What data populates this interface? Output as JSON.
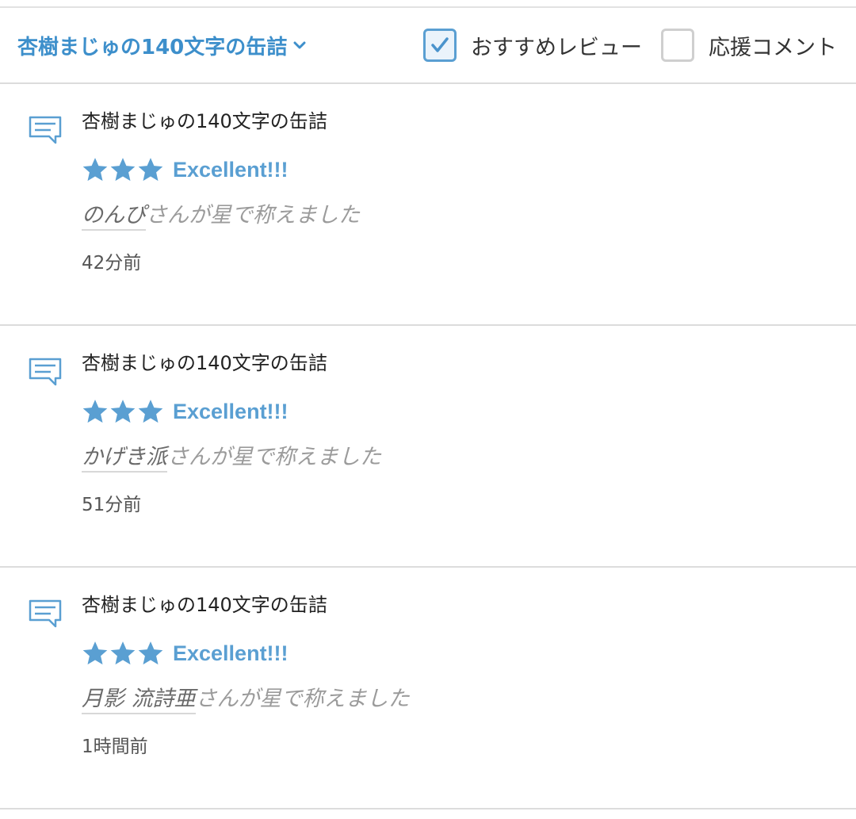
{
  "header": {
    "work_title": "杏樹まじゅの140文字の缶詰",
    "filters": [
      {
        "label": "おすすめレビュー",
        "checked": true
      },
      {
        "label": "応援コメント",
        "checked": false
      }
    ]
  },
  "colors": {
    "accent": "#5a9fd2",
    "link": "#3d8fcb",
    "divider": "#dcdcdc",
    "muted_text": "#9b9b9b"
  },
  "reviews": [
    {
      "icon": "comment-icon",
      "work_title": "杏樹まじゅの140文字の缶詰",
      "stars": 3,
      "rating_label": "Excellent!!!",
      "user": "のんぴ",
      "action": "さんが星で称えました",
      "time": "42分前"
    },
    {
      "icon": "comment-icon",
      "work_title": "杏樹まじゅの140文字の缶詰",
      "stars": 3,
      "rating_label": "Excellent!!!",
      "user": "かげき派",
      "action": "さんが星で称えました",
      "time": "51分前"
    },
    {
      "icon": "comment-icon",
      "work_title": "杏樹まじゅの140文字の缶詰",
      "stars": 3,
      "rating_label": "Excellent!!!",
      "user": "月影 流詩亜",
      "action": "さんが星で称えました",
      "time": "1時間前"
    }
  ]
}
